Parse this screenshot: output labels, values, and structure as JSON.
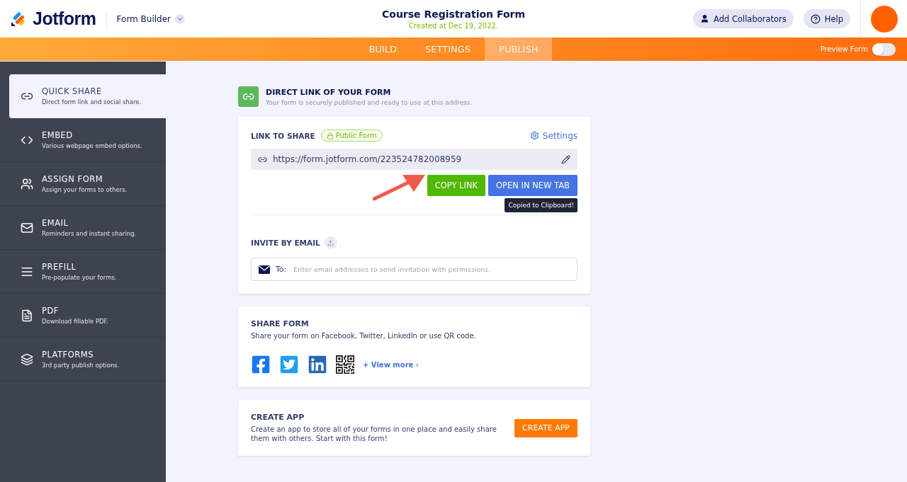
{
  "header": {
    "brand": "Jotform",
    "product": "Form Builder",
    "title": "Course Registration Form",
    "subtitle": "Created at Dec 19, 2022.",
    "buttons": [
      "Add Collaborators",
      "Help"
    ]
  },
  "tabs": [
    {
      "label": "BUILD",
      "selected": false
    },
    {
      "label": "SETTINGS",
      "selected": false
    },
    {
      "label": "PUBLISH",
      "selected": true
    }
  ],
  "preview": {
    "label": "Preview Form",
    "on": false
  },
  "sidebar": {
    "items": [
      {
        "title": "QUICK SHARE",
        "desc": "Direct form link and social share.",
        "selected": true
      },
      {
        "title": "EMBED",
        "desc": "Various webpage embed options.",
        "selected": false
      },
      {
        "title": "ASSIGN FORM",
        "desc": "Assign your forms to others.",
        "selected": false
      },
      {
        "title": "EMAIL",
        "desc": "Reminders and instant sharing.",
        "selected": false
      },
      {
        "title": "PREFILL",
        "desc": "Pre-populate your forms.",
        "selected": false
      },
      {
        "title": "PDF",
        "desc": "Download fillable PDF.",
        "selected": false
      },
      {
        "title": "PLATFORMS",
        "desc": "3rd party publish options.",
        "selected": false
      }
    ]
  },
  "direct_link": {
    "title": "DIRECT LINK OF YOUR FORM",
    "subtitle": "Your form is securely published and ready to use at this address."
  },
  "link_card": {
    "label": "LINK TO SHARE",
    "badge": "Public Form",
    "settings": "Settings",
    "url": "https://form.jotform.com/223524782008959",
    "copy": "COPY LINK",
    "open": "OPEN IN NEW TAB",
    "tooltip": "Copied to Clipboard!",
    "invite_label": "INVITE BY EMAIL",
    "to": "To:",
    "placeholder": "Enter email addresses to send invitation with permissions."
  },
  "share_card": {
    "title": "SHARE FORM",
    "desc": "Share your form on Facebook, Twitter, LinkedIn or use QR code.",
    "more": "+ View more ›"
  },
  "app_card": {
    "title": "CREATE APP",
    "desc": "Create an app to store all of your forms in one place and easily share them with others. Start with this form!",
    "button": "CREATE APP"
  }
}
